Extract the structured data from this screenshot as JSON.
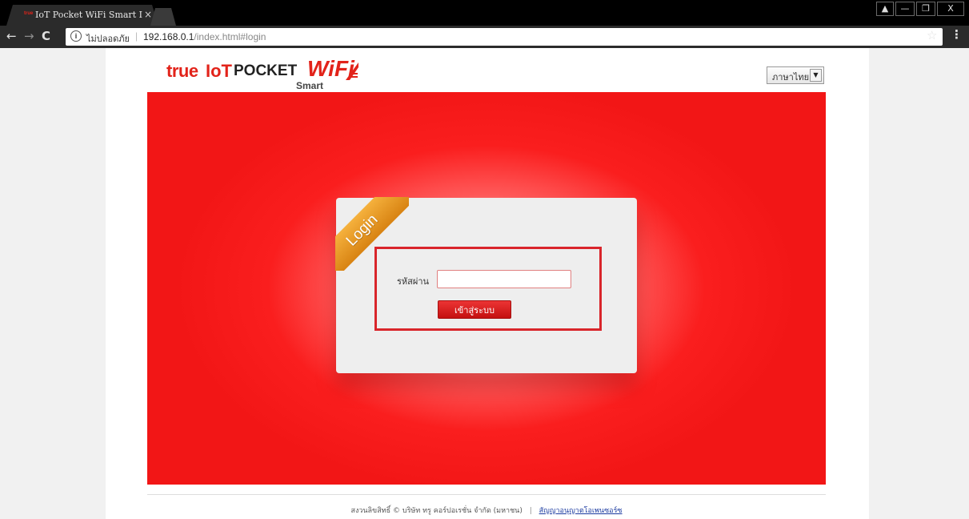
{
  "browser": {
    "tab_title": "IoT Pocket WiFi Smart I",
    "tab_favicon_text": "true",
    "tab_close": "×",
    "window_controls": {
      "user": "▲",
      "minimize": "—",
      "maximize": "❐",
      "close": "X"
    },
    "nav": {
      "back": "←",
      "forward": "→",
      "reload": "C"
    },
    "address": {
      "info_icon": "i",
      "security_label": "ไม่ปลอดภัย",
      "separator": "|",
      "host": "192.168.0.1",
      "path": "/index.html#login"
    },
    "bookmark_icon": "☆",
    "menu_icon": "⋮"
  },
  "header": {
    "logo": {
      "true": "true",
      "iot": "IoT",
      "pocket": "POCKET",
      "wifi": "WiFi",
      "smart": "Smart"
    },
    "language_select": {
      "selected": "ภาษาไทย",
      "arrow": "▼"
    }
  },
  "login": {
    "ribbon_label": "Login",
    "password_label": "รหัสผ่าน",
    "password_value": "",
    "submit_label": "เข้าสู่ระบบ"
  },
  "footer": {
    "copyright": "สงวนลิขสิทธิ์ © บริษัท ทรู คอร์ปอเรชั่น จำกัด (มหาชน)",
    "separator": "|",
    "license_link": "สัญญาอนุญาตโอเพนซอร์ซ"
  },
  "colors": {
    "brand_red": "#e2231a",
    "ribbon_orange": "#f0a22a",
    "highlight_border": "#d9252b"
  }
}
